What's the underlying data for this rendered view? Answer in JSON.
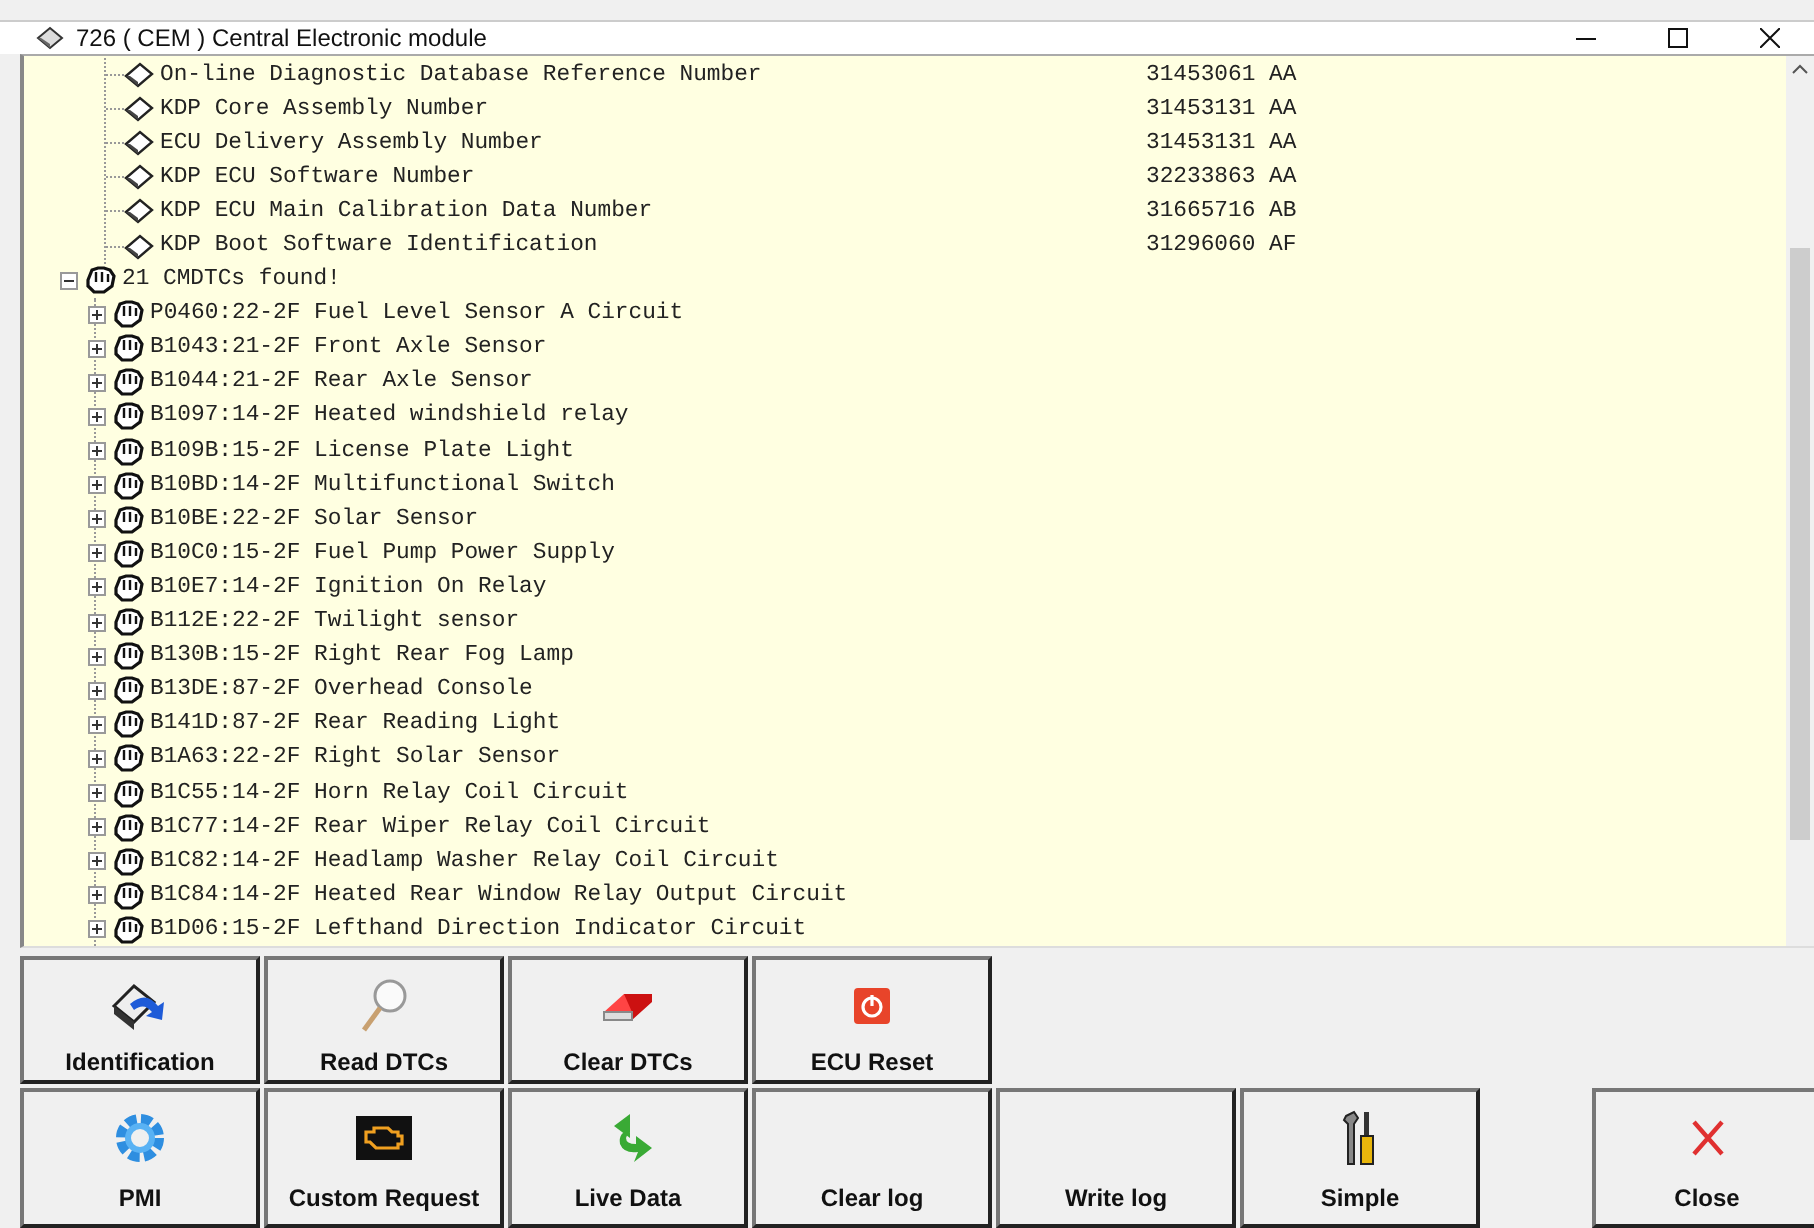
{
  "window": {
    "title": "726 ( CEM ) Central Electronic module"
  },
  "info_items": [
    {
      "label": "On-line Diagnostic Database Reference Number",
      "value": "31453061 AA"
    },
    {
      "label": "KDP Core Assembly Number",
      "value": "31453131 AA"
    },
    {
      "label": "ECU Delivery Assembly Number",
      "value": "31453131 AA"
    },
    {
      "label": "KDP ECU Software Number",
      "value": "32233863 AA"
    },
    {
      "label": "KDP ECU Main Calibration Data Number",
      "value": "31665716 AB"
    },
    {
      "label": "KDP Boot Software Identification",
      "value": "31296060 AF"
    }
  ],
  "dtc_group": {
    "label": "21 CMDTCs found!",
    "expanded": true,
    "children": [
      {
        "label": "P0460:22-2F Fuel Level Sensor A Circuit",
        "expanded": false
      },
      {
        "label": "B1043:21-2F Front Axle Sensor",
        "expanded": false
      },
      {
        "label": "B1044:21-2F Rear Axle Sensor",
        "expanded": false
      },
      {
        "label": "B1097:14-2F Heated windshield relay",
        "expanded": false
      },
      {
        "label": "B109B:15-2F License Plate Light",
        "expanded": false
      },
      {
        "label": "B10BD:14-2F Multifunctional Switch",
        "expanded": false
      },
      {
        "label": "B10BE:22-2F Solar Sensor",
        "expanded": false
      },
      {
        "label": "B10C0:15-2F Fuel Pump Power Supply",
        "expanded": false
      },
      {
        "label": "B10E7:14-2F Ignition On Relay",
        "expanded": false
      },
      {
        "label": "B112E:22-2F Twilight sensor",
        "expanded": false
      },
      {
        "label": "B130B:15-2F Right Rear Fog Lamp",
        "expanded": false
      },
      {
        "label": "B13DE:87-2F Overhead Console",
        "expanded": false
      },
      {
        "label": "B141D:87-2F Rear Reading Light",
        "expanded": false
      },
      {
        "label": "B1A63:22-2F Right Solar Sensor",
        "expanded": false
      },
      {
        "label": "B1C55:14-2F Horn Relay Coil Circuit",
        "expanded": false
      },
      {
        "label": "B1C77:14-2F Rear Wiper Relay Coil Circuit",
        "expanded": false
      },
      {
        "label": "B1C82:14-2F Headlamp Washer Relay Coil Circuit",
        "expanded": false
      },
      {
        "label": "B1C84:14-2F Heated Rear Window Relay Output Circuit",
        "expanded": false
      },
      {
        "label": "B1D06:15-2F Lefthand Direction Indicator Circuit",
        "expanded": false
      }
    ]
  },
  "button_rows": [
    [
      {
        "label": "Identification",
        "kind": "module"
      },
      {
        "label": "Read DTCs",
        "kind": "magnifier"
      },
      {
        "label": "Clear DTCs",
        "kind": "eraser"
      },
      {
        "label": "ECU Reset",
        "kind": "power"
      }
    ],
    [
      {
        "label": "PMI",
        "kind": "gear"
      },
      {
        "label": "Custom Request",
        "kind": "engine"
      },
      {
        "label": "Live Data",
        "kind": "arrow"
      },
      {
        "label": "Clear log",
        "kind": "text"
      },
      {
        "label": "Write log",
        "kind": "text"
      },
      {
        "label": "Simple",
        "kind": "tools"
      }
    ]
  ],
  "close_button": {
    "label": "Close",
    "kind": "cross"
  }
}
